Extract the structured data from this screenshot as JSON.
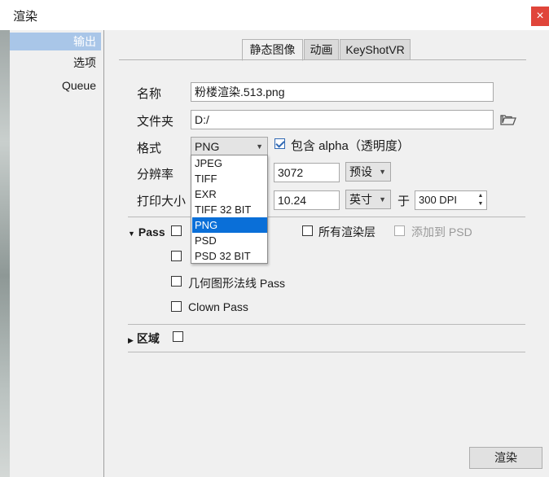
{
  "window": {
    "title": "渲染",
    "close_glyph": "×"
  },
  "sidebar": {
    "items": [
      {
        "label": "输出"
      },
      {
        "label": "选项"
      },
      {
        "label": "Queue"
      }
    ]
  },
  "tabs": [
    {
      "label": "静态图像"
    },
    {
      "label": "动画"
    },
    {
      "label": "KeyShotVR"
    }
  ],
  "form": {
    "name_label": "名称",
    "name_value": "粉楼渲染.513.png",
    "folder_label": "文件夹",
    "folder_value": "D:/",
    "folder_icon": "folder-open-icon",
    "format_label": "格式",
    "format_value": "PNG",
    "alpha_label": "包含 alpha（透明度）",
    "alpha_checked": true,
    "resolution_label": "分辨率",
    "resolution_value": "3072",
    "preset_label": "预设",
    "print_size_label": "打印大小",
    "print_size_value": "10.24",
    "unit_value": "英寸",
    "at_label": "于",
    "dpi_value": "300 DPI"
  },
  "format_options": [
    "JPEG",
    "TIFF",
    "EXR",
    "TIFF 32 BIT",
    "PNG",
    "PSD",
    "PSD 32 BIT"
  ],
  "pass_section": {
    "title": "Pass",
    "all_layers_label": "所有渲染层",
    "add_to_psd_label": "添加到 PSD",
    "geometry_normal_label": "几何图形法线 Pass",
    "clown_pass_label": "Clown Pass"
  },
  "region_section": {
    "title": "区域"
  },
  "footer": {
    "render_button": "渲染"
  },
  "colors": {
    "accent": "#0a6fd8",
    "sidebar_active": "#a9c6e8",
    "close": "#e0453a"
  }
}
